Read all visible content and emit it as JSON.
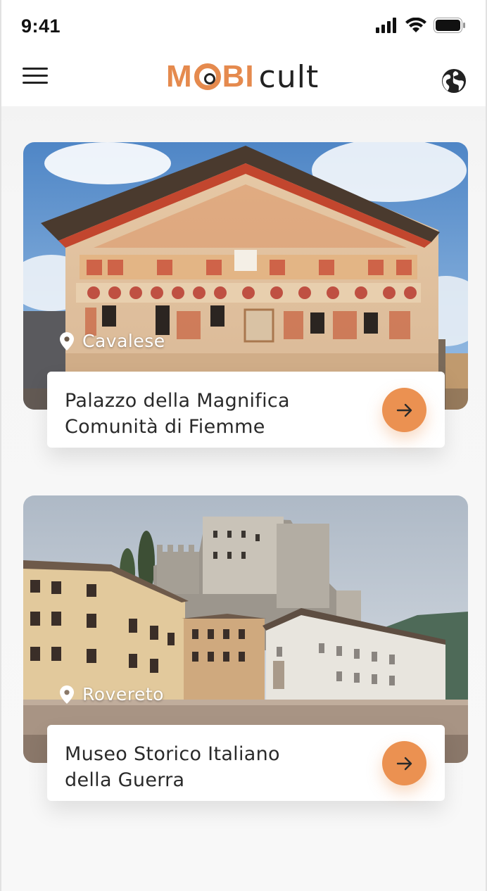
{
  "status_bar": {
    "time": "9:41",
    "icons": [
      "signal-icon",
      "wifi-icon",
      "battery-icon"
    ]
  },
  "header": {
    "menu_icon": "hamburger-menu-icon",
    "logo_mobi": "MOBI",
    "logo_cult": "cult",
    "language_icon": "globe-icon"
  },
  "colors": {
    "accent": "#eb9151",
    "logo_orange": "#e58a4e",
    "text": "#2a2a2a"
  },
  "cards": [
    {
      "location": "Cavalese",
      "title_line1": "Palazzo della Magnifica",
      "title_line2": "Comunità di Fiemme",
      "image": "painted-palace-facade"
    },
    {
      "location": "Rovereto",
      "title_line1": "Museo Storico Italiano",
      "title_line2": "della Guerra",
      "image": "castle-on-hill"
    }
  ]
}
